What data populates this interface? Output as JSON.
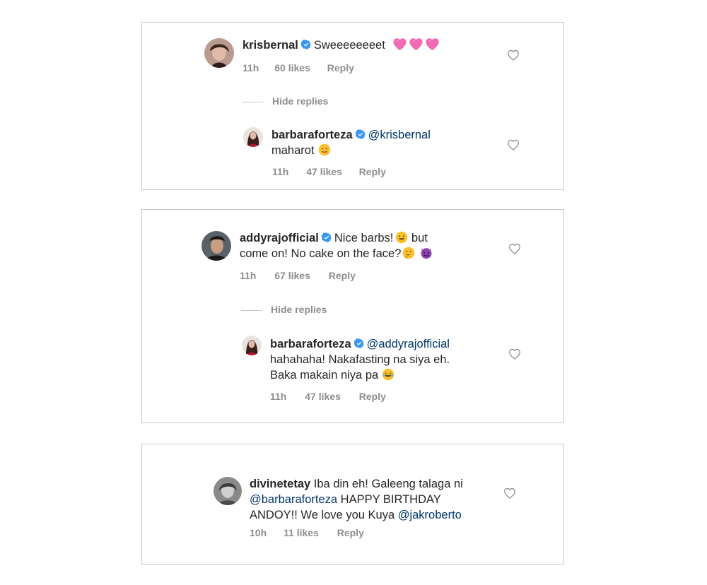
{
  "thread1": {
    "comment": {
      "username": "krisbernal",
      "text": "Sweeeeeeeet",
      "emojis": [
        "pink-heart-emoji",
        "pink-heart-emoji",
        "pink-heart-emoji"
      ],
      "time": "11h",
      "likes": "60 likes",
      "reply_label": "Reply"
    },
    "hide_replies_label": "Hide replies",
    "reply": {
      "username": "barbaraforteza",
      "mention": "@krisbernal",
      "text": "maharot",
      "time": "11h",
      "likes": "47 likes",
      "reply_label": "Reply"
    }
  },
  "thread2": {
    "comment": {
      "username": "addyrajofficial",
      "text_line1": "Nice barbs!",
      "text_line1_end": "but",
      "text_line2": "come on! No cake on the face?",
      "time": "11h",
      "likes": "67 likes",
      "reply_label": "Reply"
    },
    "hide_replies_label": "Hide replies",
    "reply": {
      "username": "barbaraforteza",
      "mention": "@addyrajofficial",
      "text_line1": "hahahaha! Nakafasting na siya eh.",
      "text_line2": "Baka makain niya pa",
      "time": "11h",
      "likes": "47 likes",
      "reply_label": "Reply"
    }
  },
  "thread3": {
    "comment": {
      "username": "divinetetay",
      "text_line1": "Iba din eh! Galeeng talaga ni",
      "mention1": "@barbaraforteza",
      "text_line2": "HAPPY BIRTHDAY",
      "text_line3": "ANDOY!! We love you Kuya",
      "mention2": "@jakroberto",
      "time": "10h",
      "likes": "11 likes",
      "reply_label": "Reply"
    }
  },
  "colors": {
    "verified": "#3897f0",
    "mention": "#00376b",
    "meta": "#8e8e8e",
    "border": "#c9c9c9"
  }
}
